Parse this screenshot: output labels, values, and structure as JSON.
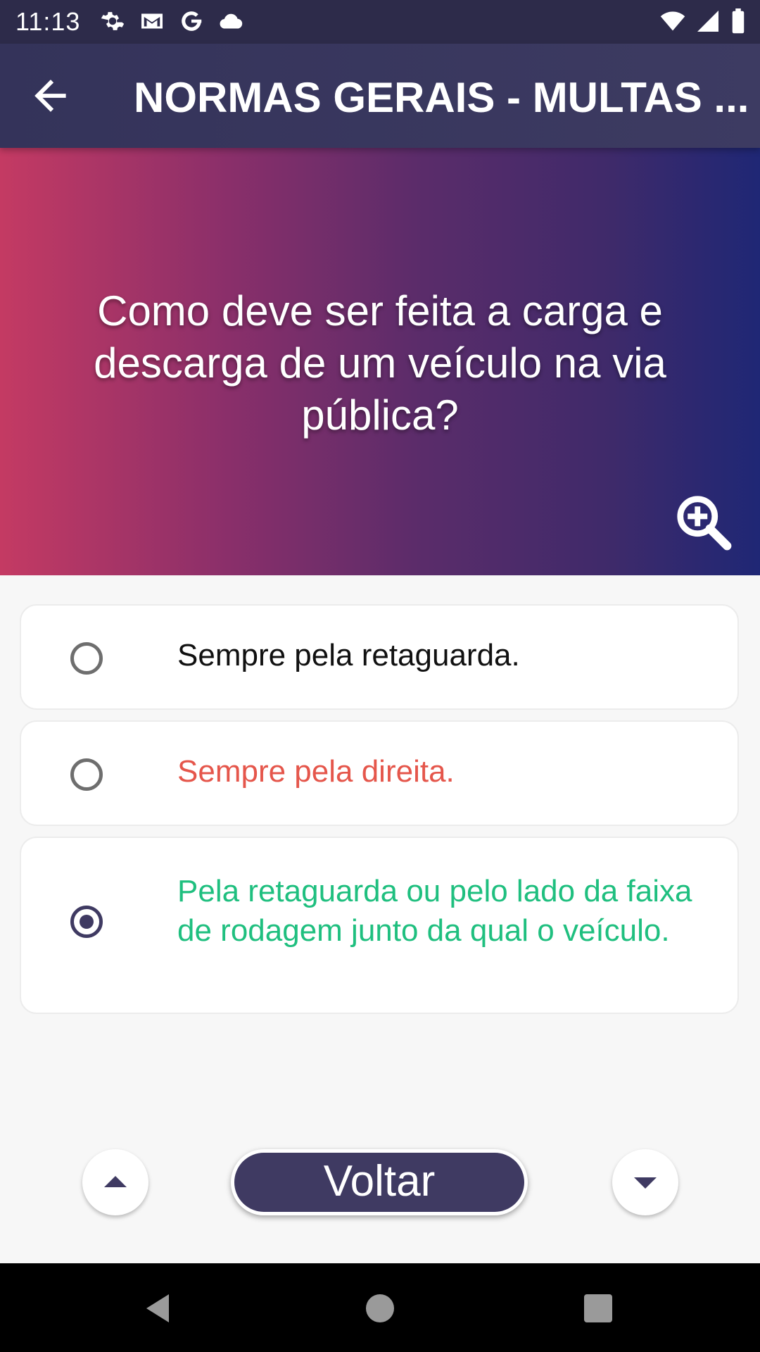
{
  "status_bar": {
    "time": "11:13",
    "icons_left": [
      "settings-icon",
      "gmail-icon",
      "google-icon",
      "cloud-icon"
    ],
    "icons_right": [
      "wifi-icon",
      "signal-icon",
      "battery-icon"
    ]
  },
  "app_bar": {
    "back_icon": "arrow-back-icon",
    "title": "NORMAS GERAIS - MULTAS ..."
  },
  "question": {
    "text": "Como deve ser feita a carga e descarga de um veículo na via pública?",
    "zoom_icon": "zoom-in-icon",
    "gradient_colors": [
      "#c43a63",
      "#1f2775"
    ]
  },
  "options": [
    {
      "text": "Sempre pela retaguarda.",
      "selected": false,
      "color": "#111111"
    },
    {
      "text": "Sempre pela direita.",
      "selected": false,
      "color": "#e5564b"
    },
    {
      "text": "Pela retaguarda ou pelo lado da faixa de rodagem junto da qual o veículo.",
      "selected": true,
      "color": "#1fbf7f"
    }
  ],
  "controls": {
    "previous_icon": "triangle-up-icon",
    "next_icon": "triangle-down-icon",
    "voltar_label": "Voltar",
    "accent_color": "#3f3a62"
  },
  "system_nav": {
    "back_icon": "nav-back-icon",
    "home_icon": "nav-home-icon",
    "recents_icon": "nav-recents-icon"
  }
}
